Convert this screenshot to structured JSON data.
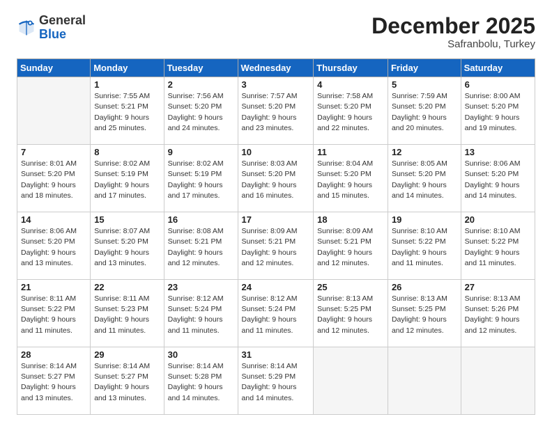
{
  "header": {
    "logo_general": "General",
    "logo_blue": "Blue",
    "month": "December 2025",
    "location": "Safranbolu, Turkey"
  },
  "weekdays": [
    "Sunday",
    "Monday",
    "Tuesday",
    "Wednesday",
    "Thursday",
    "Friday",
    "Saturday"
  ],
  "weeks": [
    [
      {
        "day": "",
        "lines": []
      },
      {
        "day": "1",
        "lines": [
          "Sunrise: 7:55 AM",
          "Sunset: 5:21 PM",
          "Daylight: 9 hours",
          "and 25 minutes."
        ]
      },
      {
        "day": "2",
        "lines": [
          "Sunrise: 7:56 AM",
          "Sunset: 5:20 PM",
          "Daylight: 9 hours",
          "and 24 minutes."
        ]
      },
      {
        "day": "3",
        "lines": [
          "Sunrise: 7:57 AM",
          "Sunset: 5:20 PM",
          "Daylight: 9 hours",
          "and 23 minutes."
        ]
      },
      {
        "day": "4",
        "lines": [
          "Sunrise: 7:58 AM",
          "Sunset: 5:20 PM",
          "Daylight: 9 hours",
          "and 22 minutes."
        ]
      },
      {
        "day": "5",
        "lines": [
          "Sunrise: 7:59 AM",
          "Sunset: 5:20 PM",
          "Daylight: 9 hours",
          "and 20 minutes."
        ]
      },
      {
        "day": "6",
        "lines": [
          "Sunrise: 8:00 AM",
          "Sunset: 5:20 PM",
          "Daylight: 9 hours",
          "and 19 minutes."
        ]
      }
    ],
    [
      {
        "day": "7",
        "lines": [
          "Sunrise: 8:01 AM",
          "Sunset: 5:20 PM",
          "Daylight: 9 hours",
          "and 18 minutes."
        ]
      },
      {
        "day": "8",
        "lines": [
          "Sunrise: 8:02 AM",
          "Sunset: 5:19 PM",
          "Daylight: 9 hours",
          "and 17 minutes."
        ]
      },
      {
        "day": "9",
        "lines": [
          "Sunrise: 8:02 AM",
          "Sunset: 5:19 PM",
          "Daylight: 9 hours",
          "and 17 minutes."
        ]
      },
      {
        "day": "10",
        "lines": [
          "Sunrise: 8:03 AM",
          "Sunset: 5:20 PM",
          "Daylight: 9 hours",
          "and 16 minutes."
        ]
      },
      {
        "day": "11",
        "lines": [
          "Sunrise: 8:04 AM",
          "Sunset: 5:20 PM",
          "Daylight: 9 hours",
          "and 15 minutes."
        ]
      },
      {
        "day": "12",
        "lines": [
          "Sunrise: 8:05 AM",
          "Sunset: 5:20 PM",
          "Daylight: 9 hours",
          "and 14 minutes."
        ]
      },
      {
        "day": "13",
        "lines": [
          "Sunrise: 8:06 AM",
          "Sunset: 5:20 PM",
          "Daylight: 9 hours",
          "and 14 minutes."
        ]
      }
    ],
    [
      {
        "day": "14",
        "lines": [
          "Sunrise: 8:06 AM",
          "Sunset: 5:20 PM",
          "Daylight: 9 hours",
          "and 13 minutes."
        ]
      },
      {
        "day": "15",
        "lines": [
          "Sunrise: 8:07 AM",
          "Sunset: 5:20 PM",
          "Daylight: 9 hours",
          "and 13 minutes."
        ]
      },
      {
        "day": "16",
        "lines": [
          "Sunrise: 8:08 AM",
          "Sunset: 5:21 PM",
          "Daylight: 9 hours",
          "and 12 minutes."
        ]
      },
      {
        "day": "17",
        "lines": [
          "Sunrise: 8:09 AM",
          "Sunset: 5:21 PM",
          "Daylight: 9 hours",
          "and 12 minutes."
        ]
      },
      {
        "day": "18",
        "lines": [
          "Sunrise: 8:09 AM",
          "Sunset: 5:21 PM",
          "Daylight: 9 hours",
          "and 12 minutes."
        ]
      },
      {
        "day": "19",
        "lines": [
          "Sunrise: 8:10 AM",
          "Sunset: 5:22 PM",
          "Daylight: 9 hours",
          "and 11 minutes."
        ]
      },
      {
        "day": "20",
        "lines": [
          "Sunrise: 8:10 AM",
          "Sunset: 5:22 PM",
          "Daylight: 9 hours",
          "and 11 minutes."
        ]
      }
    ],
    [
      {
        "day": "21",
        "lines": [
          "Sunrise: 8:11 AM",
          "Sunset: 5:22 PM",
          "Daylight: 9 hours",
          "and 11 minutes."
        ]
      },
      {
        "day": "22",
        "lines": [
          "Sunrise: 8:11 AM",
          "Sunset: 5:23 PM",
          "Daylight: 9 hours",
          "and 11 minutes."
        ]
      },
      {
        "day": "23",
        "lines": [
          "Sunrise: 8:12 AM",
          "Sunset: 5:24 PM",
          "Daylight: 9 hours",
          "and 11 minutes."
        ]
      },
      {
        "day": "24",
        "lines": [
          "Sunrise: 8:12 AM",
          "Sunset: 5:24 PM",
          "Daylight: 9 hours",
          "and 11 minutes."
        ]
      },
      {
        "day": "25",
        "lines": [
          "Sunrise: 8:13 AM",
          "Sunset: 5:25 PM",
          "Daylight: 9 hours",
          "and 12 minutes."
        ]
      },
      {
        "day": "26",
        "lines": [
          "Sunrise: 8:13 AM",
          "Sunset: 5:25 PM",
          "Daylight: 9 hours",
          "and 12 minutes."
        ]
      },
      {
        "day": "27",
        "lines": [
          "Sunrise: 8:13 AM",
          "Sunset: 5:26 PM",
          "Daylight: 9 hours",
          "and 12 minutes."
        ]
      }
    ],
    [
      {
        "day": "28",
        "lines": [
          "Sunrise: 8:14 AM",
          "Sunset: 5:27 PM",
          "Daylight: 9 hours",
          "and 13 minutes."
        ]
      },
      {
        "day": "29",
        "lines": [
          "Sunrise: 8:14 AM",
          "Sunset: 5:27 PM",
          "Daylight: 9 hours",
          "and 13 minutes."
        ]
      },
      {
        "day": "30",
        "lines": [
          "Sunrise: 8:14 AM",
          "Sunset: 5:28 PM",
          "Daylight: 9 hours",
          "and 14 minutes."
        ]
      },
      {
        "day": "31",
        "lines": [
          "Sunrise: 8:14 AM",
          "Sunset: 5:29 PM",
          "Daylight: 9 hours",
          "and 14 minutes."
        ]
      },
      {
        "day": "",
        "lines": []
      },
      {
        "day": "",
        "lines": []
      },
      {
        "day": "",
        "lines": []
      }
    ]
  ]
}
